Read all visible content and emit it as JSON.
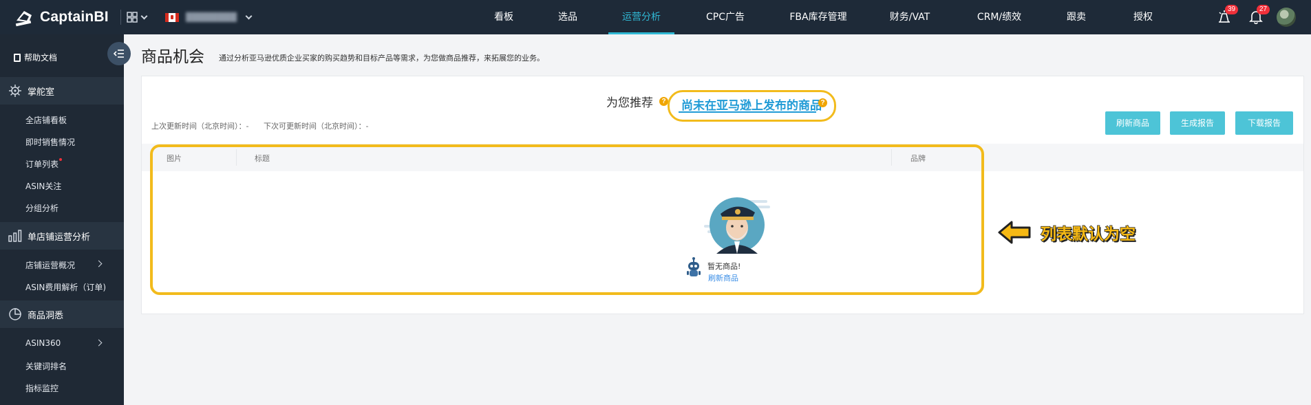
{
  "app": {
    "brand": "CaptainBI",
    "store_name": "████████"
  },
  "nav": {
    "items": [
      {
        "label": "看板"
      },
      {
        "label": "选品"
      },
      {
        "label": "运营分析"
      },
      {
        "label": "CPC广告"
      },
      {
        "label": "FBA库存管理"
      },
      {
        "label": "财务/VAT"
      },
      {
        "label": "CRM/绩效"
      },
      {
        "label": "跟卖"
      },
      {
        "label": "授权"
      }
    ],
    "active_index": 2,
    "notif_badge_1": "39",
    "notif_badge_2": "27"
  },
  "sidebar": {
    "help": "帮助文档",
    "groups": [
      {
        "label": "掌舵室",
        "items": [
          "全店铺看板",
          "即时销售情况",
          "订单列表",
          "ASIN关注",
          "分组分析"
        ]
      },
      {
        "label": "单店铺运营分析",
        "items": [
          "店铺运营概况",
          "ASIN费用解析（订单)"
        ]
      },
      {
        "label": "商品洞悉",
        "items": [
          "ASIN360",
          "关键词排名",
          "指标监控"
        ]
      }
    ]
  },
  "page": {
    "title": "商品机会",
    "description": "通过分析亚马逊优质企业买家的购买趋势和目标产品等需求，为您做商品推荐，来拓展您的业务。",
    "tab_recommend": "为您推荐",
    "tab_not_published": "尚未在亚马逊上发布的商品",
    "last_update": "上次更新时间（北京时间）：-",
    "next_update": "下次可更新时间（北京时间）：-",
    "buttons": {
      "refresh": "刷新商品",
      "generate": "生成报告",
      "download": "下载报告"
    },
    "table": {
      "columns": [
        "图片",
        "标题",
        "品牌"
      ]
    },
    "empty_text": "暂无商品!",
    "empty_link": "刷新商品",
    "annotation": "列表默认为空"
  },
  "colors": {
    "accent": "#30b8d4",
    "highlight": "#f2bb1c",
    "button": "#4dc4d7"
  }
}
